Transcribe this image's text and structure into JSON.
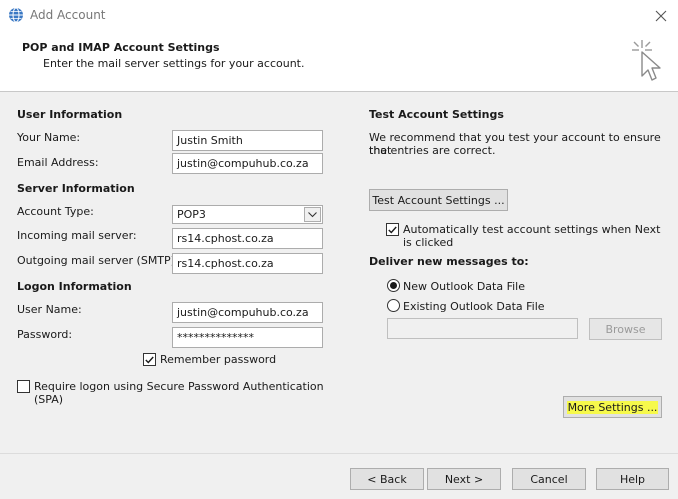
{
  "window": {
    "title": "Add Account"
  },
  "header": {
    "title": "POP and IMAP Account Settings",
    "subtitle": "Enter the mail server settings for your account."
  },
  "user_info": {
    "section": "User Information",
    "name_label": "Your Name:",
    "name_value": "Justin Smith",
    "email_label": "Email Address:",
    "email_value": "justin@compuhub.co.za"
  },
  "server_info": {
    "section": "Server Information",
    "account_type_label": "Account Type:",
    "account_type_value": "POP3",
    "incoming_label": "Incoming mail server:",
    "incoming_value": "rs14.cphost.co.za",
    "outgoing_label": "Outgoing mail server (SMTP):",
    "outgoing_value": "rs14.cphost.co.za"
  },
  "logon_info": {
    "section": "Logon Information",
    "user_label": "User Name:",
    "user_value": "justin@compuhub.co.za",
    "password_label": "Password:",
    "password_value": "**************",
    "remember_label": "Remember password",
    "remember_checked": true,
    "spa_label_1": "Require logon using Secure Password Authentication",
    "spa_label_2": "(SPA)",
    "spa_checked": false
  },
  "test_settings": {
    "section": "Test Account Settings",
    "desc_1": "We recommend that you test your account to ensure that",
    "desc_2": "the entries are correct.",
    "test_button": "Test Account Settings ...",
    "auto_test_1": "Automatically test account settings when Next",
    "auto_test_2": "is clicked",
    "auto_test_checked": true
  },
  "deliver": {
    "section": "Deliver new messages to:",
    "new_file": "New Outlook Data File",
    "existing_file": "Existing Outlook Data File",
    "selected": "new",
    "path_value": "",
    "browse_button": "Browse"
  },
  "more_settings_button": "More Settings ...",
  "footer": {
    "back": "< Back",
    "next": "Next >",
    "cancel": "Cancel",
    "help": "Help"
  },
  "colors": {
    "highlight": "#f6f94b",
    "dialog_bg": "#f0f0f0"
  },
  "icons": {
    "app": "outlook-globe-icon",
    "close": "close-icon",
    "cursor": "click-cursor-icon",
    "dropdown": "chevron-down-icon",
    "check": "checkmark-icon"
  }
}
